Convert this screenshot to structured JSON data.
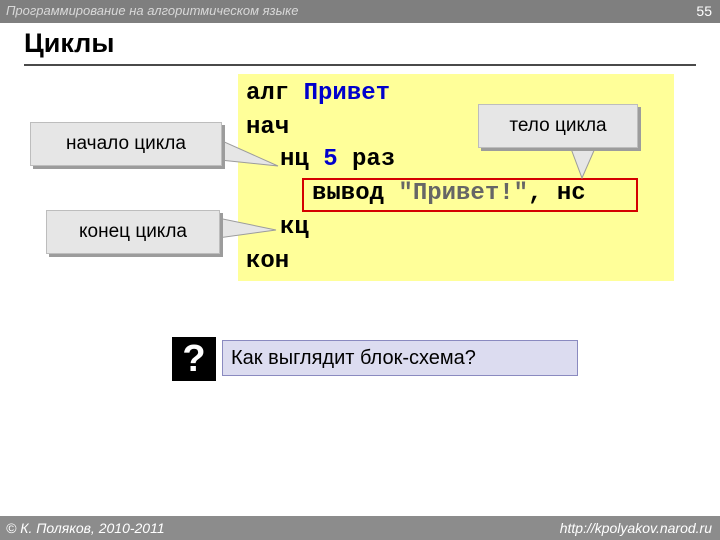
{
  "header": {
    "subject": "Программирование на алгоритмическом языке",
    "page_number": "55"
  },
  "slide": {
    "title": "Циклы"
  },
  "code": {
    "line1_kw": "алг",
    "line1_name": "Привет",
    "line2": "нач",
    "line3_kw": "нц",
    "line3_num": "5",
    "line3_rest": "раз",
    "line4_kw": "вывод",
    "line4_str": "\"Привет!\"",
    "line4_rest": ", нс",
    "line5": "кц",
    "line6": "кон"
  },
  "callouts": {
    "loop_start": "начало цикла",
    "loop_end": "конец цикла",
    "loop_body": "тело цикла"
  },
  "question": {
    "mark": "?",
    "text": "Как выглядит блок-схема?"
  },
  "footer": {
    "copyright": "© К. Поляков, 2010-2011",
    "url": "http://kpolyakov.narod.ru"
  },
  "colors": {
    "code_background": "#ffff99",
    "keyword_blue": "#0000cc",
    "highlight_border": "#d40000",
    "question_box": "#dcdcf0"
  }
}
